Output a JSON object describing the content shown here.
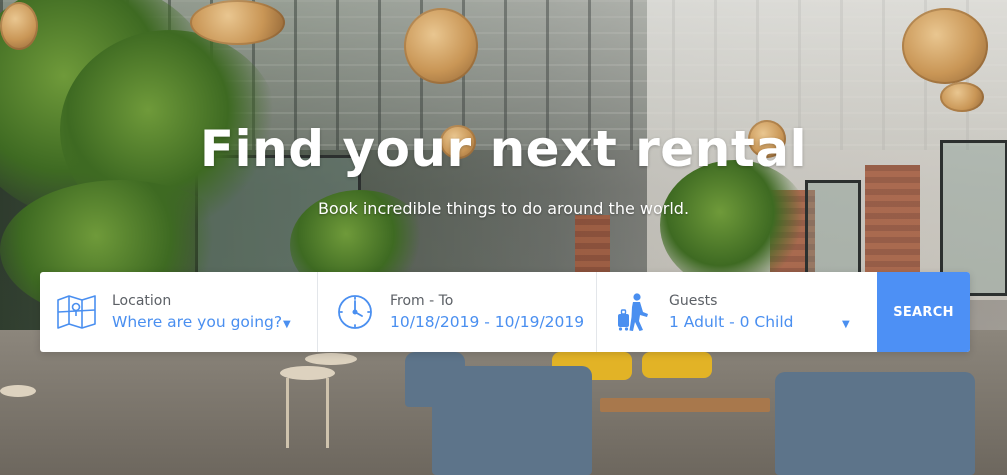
{
  "hero": {
    "title": "Find your next rental",
    "subtitle": "Book incredible things to do around the world."
  },
  "search": {
    "location": {
      "label": "Location",
      "value": "Where are you going?",
      "icon": "map-icon"
    },
    "dates": {
      "label": "From - To",
      "value": "10/18/2019 - 10/19/2019",
      "icon": "clock-icon"
    },
    "guests": {
      "label": "Guests",
      "value": "1 Adult - 0 Child",
      "icon": "traveler-icon"
    },
    "button_label": "SEARCH"
  },
  "colors": {
    "accent": "#4d90f5",
    "value_text": "#4a8ff0",
    "label_text": "#5c6066"
  }
}
